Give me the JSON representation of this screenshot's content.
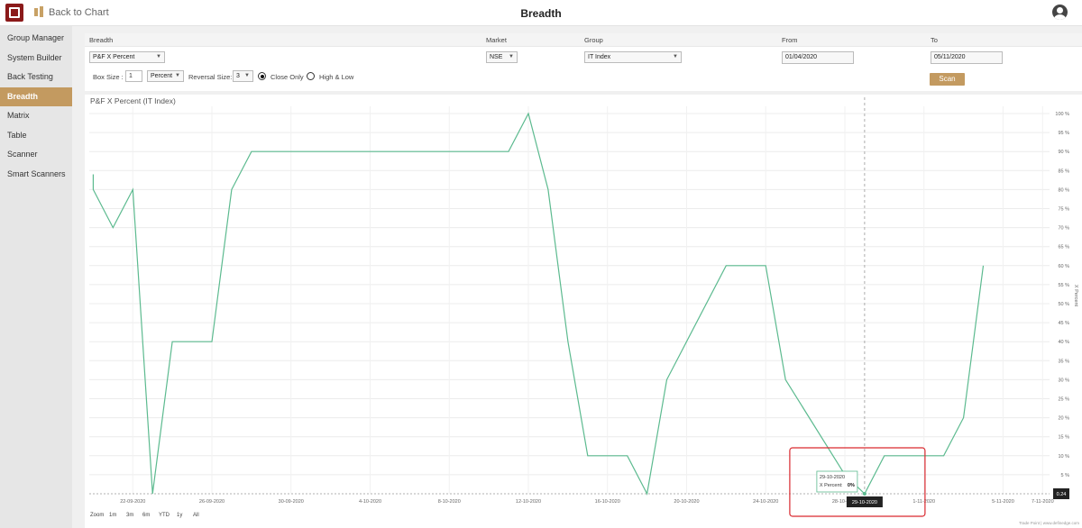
{
  "header": {
    "back_label": "Back to Chart",
    "title": "Breadth",
    "logo_icon": "tradepoint-logo-icon",
    "user_icon": "user-account-icon"
  },
  "sidebar": {
    "items": [
      {
        "label": "Group Manager",
        "active": false
      },
      {
        "label": "System Builder",
        "active": false
      },
      {
        "label": "Back Testing",
        "active": false
      },
      {
        "label": "Breadth",
        "active": true
      },
      {
        "label": "Matrix",
        "active": false
      },
      {
        "label": "Table",
        "active": false
      },
      {
        "label": "Scanner",
        "active": false
      },
      {
        "label": "Smart Scanners",
        "active": false
      }
    ]
  },
  "filters": {
    "breadth_header": "Breadth",
    "breadth_value": "P&F X Percent",
    "market_header": "Market",
    "market_value": "NSE",
    "group_header": "Group",
    "group_value": "IT Index",
    "from_header": "From",
    "from_value": "01/04/2020",
    "to_header": "To",
    "to_value": "05/11/2020",
    "box_size_label": "Box Size :",
    "box_size_value": "1",
    "box_type_value": "Percent",
    "reversal_label": "Reversal Size:",
    "reversal_value": "3",
    "close_only_label": "Close Only",
    "high_low_label": "High & Low",
    "close_only_selected": true,
    "scan_label": "Scan"
  },
  "chart_data": {
    "type": "line",
    "title": "P&F X Percent (IT Index)",
    "ylabel": "X Percent",
    "ylim": [
      0,
      100
    ],
    "y_ticks": [
      "5 %",
      "10 %",
      "15 %",
      "20 %",
      "25 %",
      "30 %",
      "35 %",
      "40 %",
      "45 %",
      "50 %",
      "55 %",
      "60 %",
      "65 %",
      "70 %",
      "75 %",
      "80 %",
      "85 %",
      "90 %",
      "95 %",
      "100 %"
    ],
    "x_ticks": [
      "22-09-2020",
      "26-09-2020",
      "30-09-2020",
      "4-10-2020",
      "8-10-2020",
      "12-10-2020",
      "16-10-2020",
      "20-10-2020",
      "24-10-2020",
      "28-10-2020",
      "1-11-2020",
      "5-11-2020",
      "7-11-2020"
    ],
    "series": [
      {
        "name": "X Percent",
        "color": "#5cba8f",
        "points": [
          [
            "2020-09-20",
            84
          ],
          [
            "2020-09-20",
            80
          ],
          [
            "2020-09-21",
            70
          ],
          [
            "2020-09-22",
            80
          ],
          [
            "2020-09-23",
            0
          ],
          [
            "2020-09-24",
            40
          ],
          [
            "2020-09-26",
            40
          ],
          [
            "2020-09-27",
            80
          ],
          [
            "2020-09-28",
            90
          ],
          [
            "2020-10-11",
            90
          ],
          [
            "2020-10-12",
            100
          ],
          [
            "2020-10-13",
            80
          ],
          [
            "2020-10-14",
            40
          ],
          [
            "2020-10-15",
            10
          ],
          [
            "2020-10-17",
            10
          ],
          [
            "2020-10-18",
            0
          ],
          [
            "2020-10-19",
            30
          ],
          [
            "2020-10-22",
            60
          ],
          [
            "2020-10-24",
            60
          ],
          [
            "2020-10-25",
            30
          ],
          [
            "2020-10-28",
            5
          ],
          [
            "2020-10-29",
            0
          ],
          [
            "2020-10-30",
            10
          ],
          [
            "2020-11-02",
            10
          ],
          [
            "2020-11-03",
            20
          ],
          [
            "2020-11-04",
            60
          ]
        ]
      }
    ],
    "tooltip": {
      "date": "29-10-2020",
      "series_label": "X Percent:",
      "value": "0%"
    },
    "crosshair_x_label": "29-10-2020",
    "crosshair_y_label": "0.24",
    "zoom": {
      "label": "Zoom",
      "options": [
        "1m",
        "3m",
        "6m",
        "YTD",
        "1y",
        "All"
      ]
    },
    "credit": "Trade Point | www.definedge.com",
    "highlight_box_color": "#d9292f",
    "grid": true
  }
}
